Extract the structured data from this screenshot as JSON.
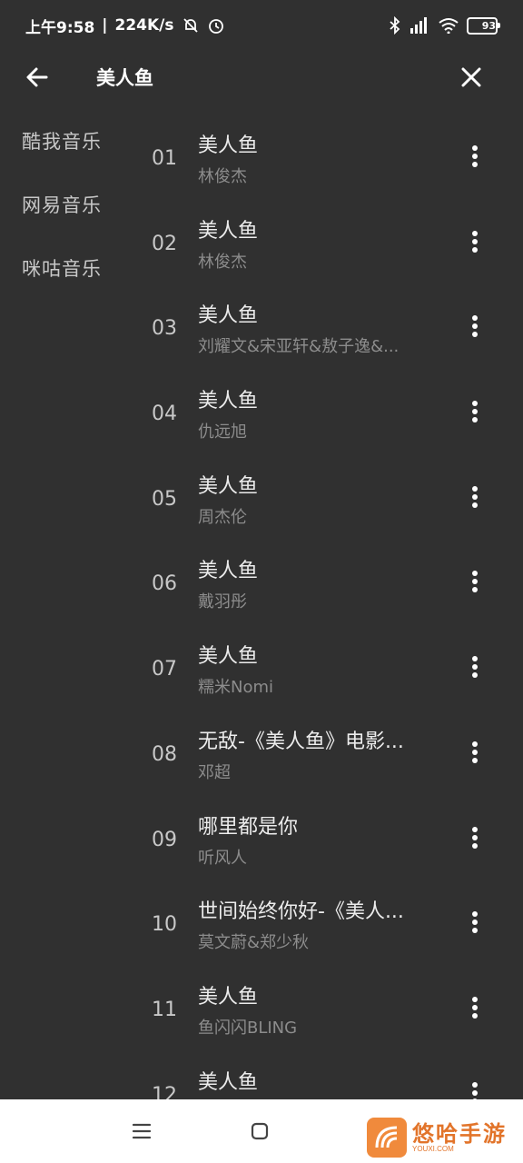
{
  "status_bar": {
    "time": "上午9:58",
    "net_speed": "224K/s",
    "battery": "93",
    "battery_level": 0.93
  },
  "header": {
    "title": "美人鱼"
  },
  "sources": [
    "酷我音乐",
    "网易音乐",
    "咪咕音乐"
  ],
  "songs": [
    {
      "num": "01",
      "title": "美人鱼",
      "artist": "林俊杰"
    },
    {
      "num": "02",
      "title": "美人鱼",
      "artist": "林俊杰"
    },
    {
      "num": "03",
      "title": "美人鱼",
      "artist": "刘耀文&宋亚轩&敖子逸&..."
    },
    {
      "num": "04",
      "title": "美人鱼",
      "artist": "仇远旭"
    },
    {
      "num": "05",
      "title": "美人鱼",
      "artist": "周杰伦"
    },
    {
      "num": "06",
      "title": "美人鱼",
      "artist": "戴羽彤"
    },
    {
      "num": "07",
      "title": "美人鱼",
      "artist": "糯米Nomi"
    },
    {
      "num": "08",
      "title": "无敌-《美人鱼》电影...",
      "artist": "邓超"
    },
    {
      "num": "09",
      "title": "哪里都是你",
      "artist": "听风人"
    },
    {
      "num": "10",
      "title": "世间始终你好-《美人...",
      "artist": "莫文蔚&郑少秋"
    },
    {
      "num": "11",
      "title": "美人鱼",
      "artist": "鱼闪闪BLING"
    },
    {
      "num": "12",
      "title": "美人鱼",
      "artist": ""
    }
  ],
  "watermark": {
    "text": "悠哈手游",
    "sub": "YOUXI.COM"
  }
}
